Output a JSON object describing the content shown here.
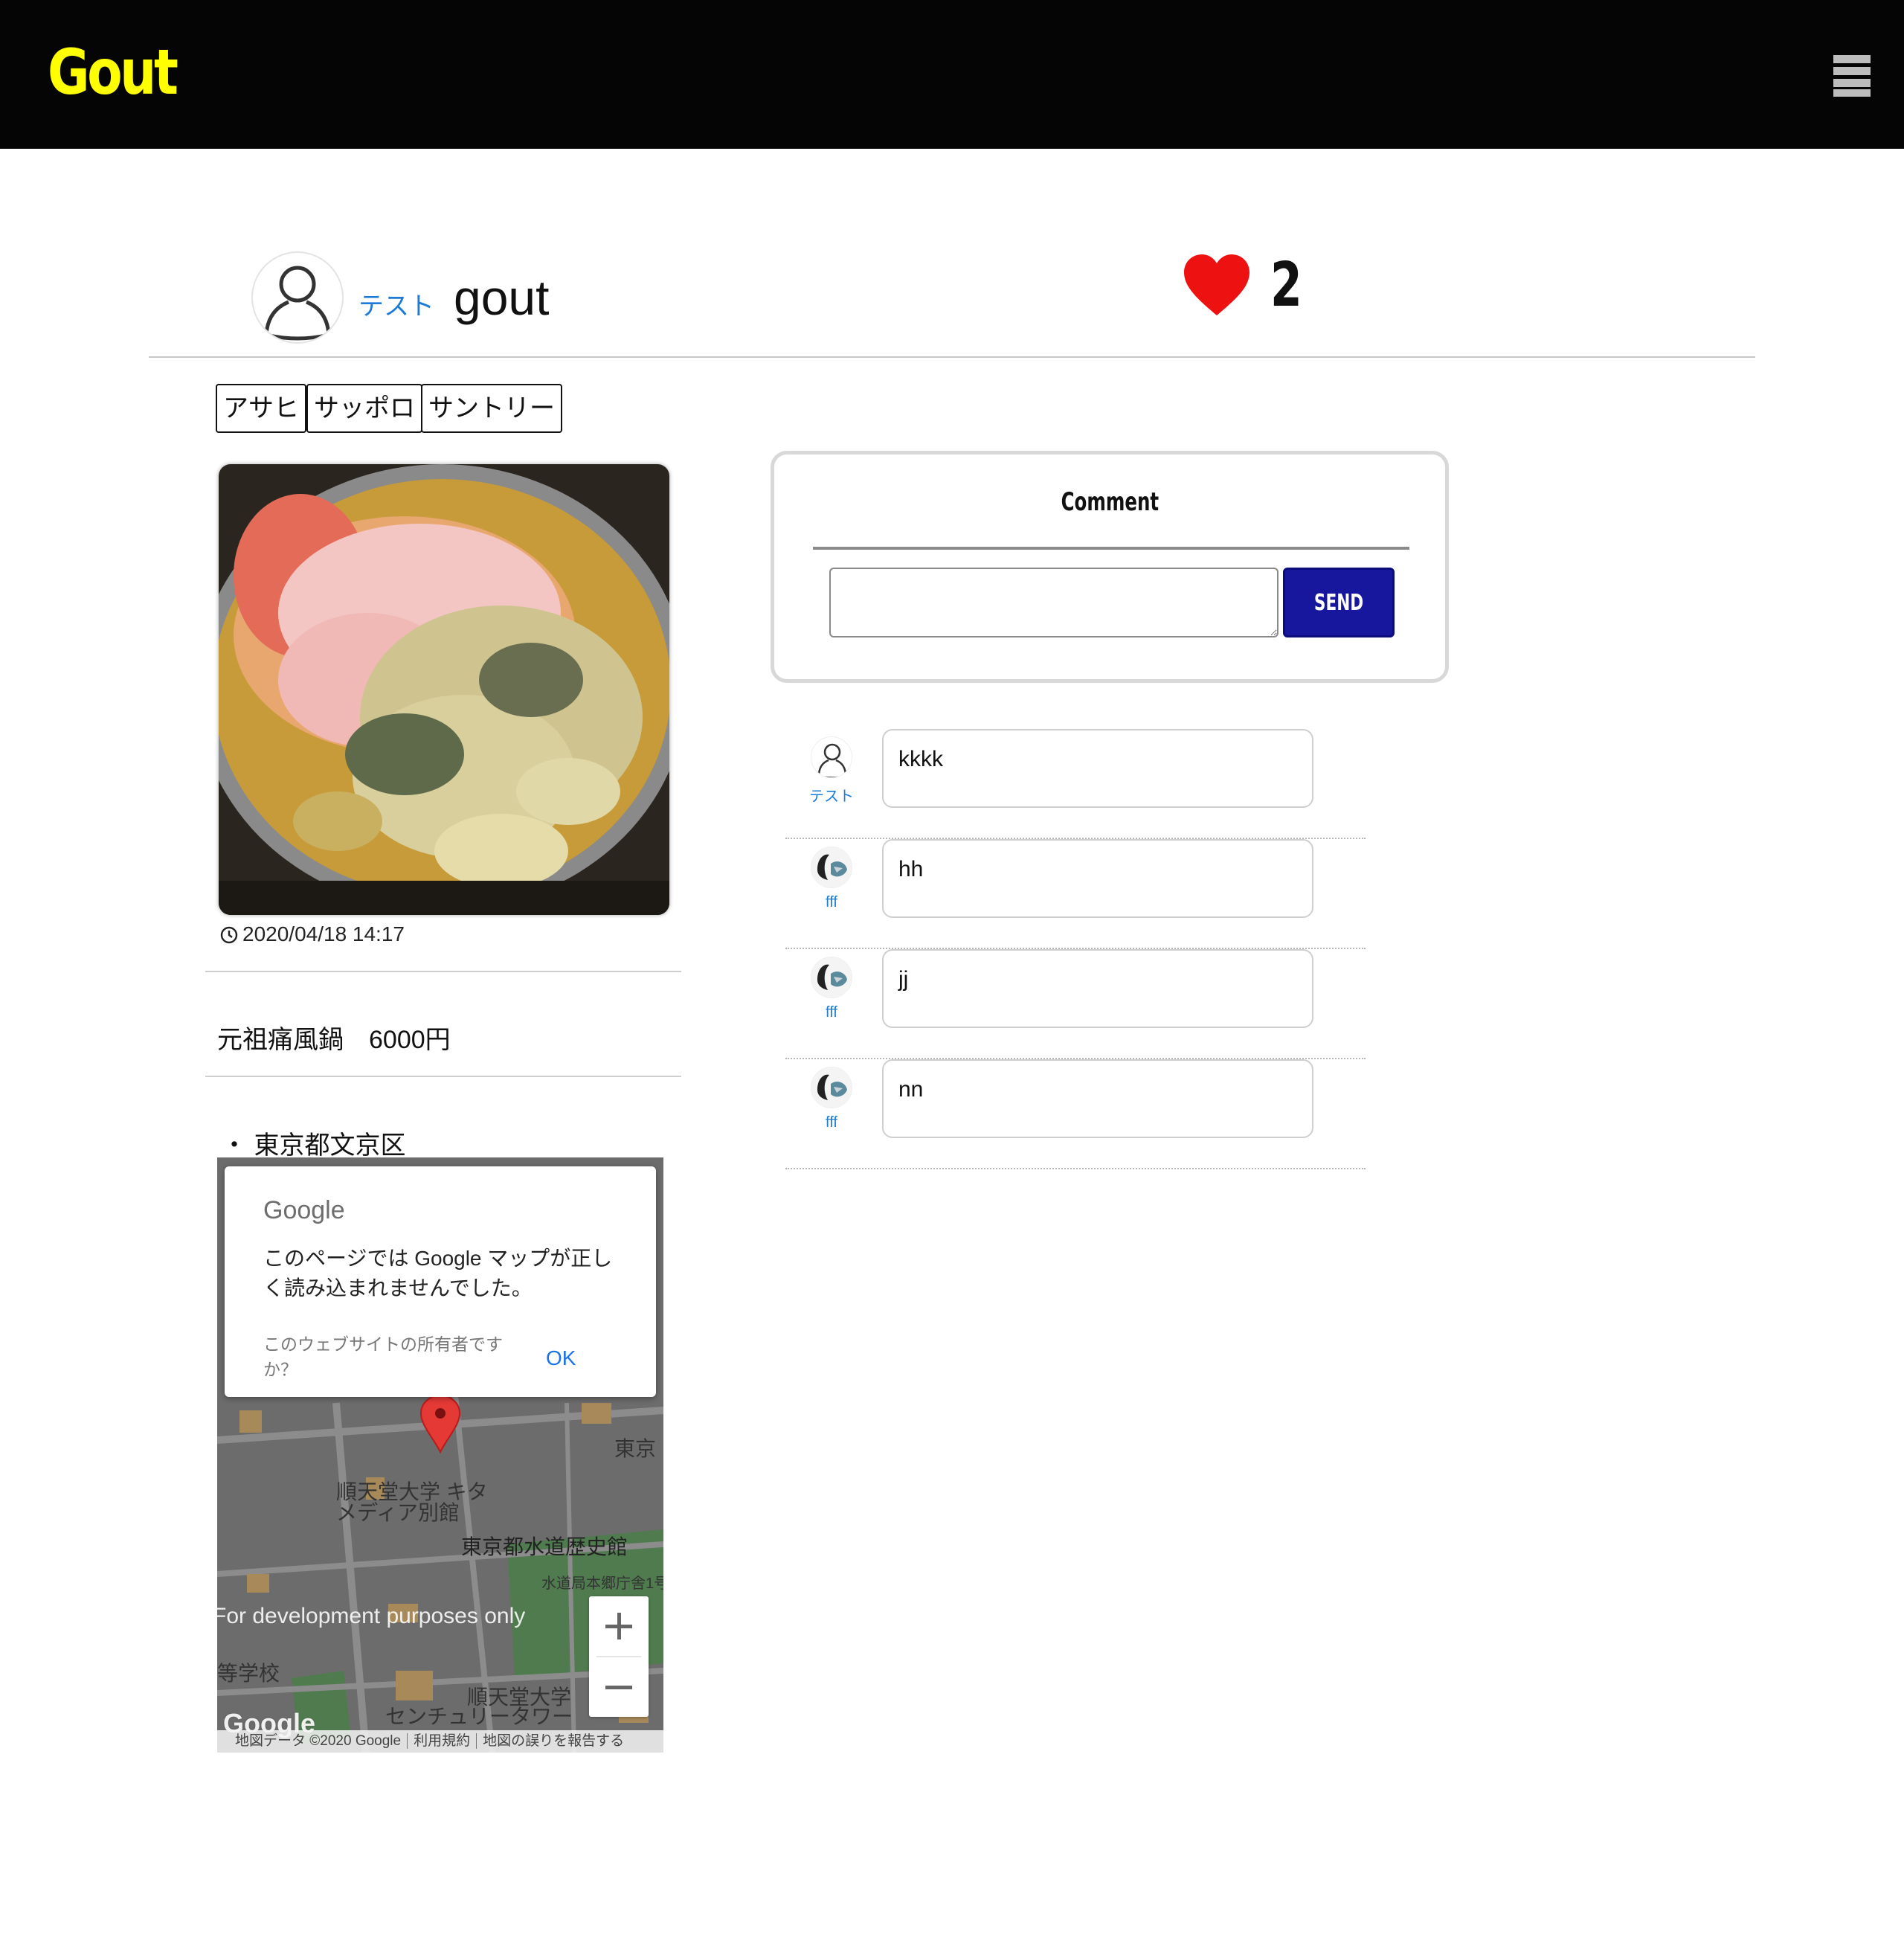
{
  "header": {
    "brand": "Gout"
  },
  "post": {
    "author": "テスト",
    "title": "gout",
    "like_count": "2",
    "tags": [
      "アサヒ",
      "サッポロ",
      "サントリー"
    ],
    "date": "2020/04/18 14:17",
    "menu": "元祖痛風鍋　6000円",
    "location": "・ 東京都文京区"
  },
  "map": {
    "dialog_logo": "Google",
    "dialog_message": "このページでは Google マップが正しく読み込まれませんでした。",
    "dialog_owner": "このウェブサイトの所有者ですか？",
    "dialog_ok": "OK",
    "dev_notice": "For development purposes only",
    "poi_1": "順天堂大学 キタ",
    "poi_1b": "メディア別館",
    "poi_2": "東京都水道歴史館",
    "poi_3": "水道局本郷庁舎1号",
    "poi_4": "順天堂大学",
    "poi_4b": "センチュリータワー",
    "poi_5": "東京",
    "poi_6": "等学校",
    "google_logo": "Google",
    "footer_data": "地図データ ©2020 Google",
    "footer_terms": "利用規約",
    "footer_report": "地図の誤りを報告する",
    "pin_color": "#e53935"
  },
  "comment_form": {
    "title": "Comment",
    "send_label": "SEND"
  },
  "comments": [
    {
      "user": "テスト",
      "text": "kkkk"
    },
    {
      "user": "fff",
      "text": "hh"
    },
    {
      "user": "fff",
      "text": "jj"
    },
    {
      "user": "fff",
      "text": "nn"
    }
  ],
  "colors": {
    "brand": "#ffff00",
    "header_bg": "#050505",
    "link": "#1c7bd6",
    "send_bg": "#16179d",
    "heart": "#ee1111"
  },
  "icons": [
    "hamburger-menu-icon",
    "user-avatar-icon",
    "heart-icon",
    "clock-icon",
    "map-pin-icon",
    "zoom-in-icon",
    "zoom-out-icon"
  ]
}
